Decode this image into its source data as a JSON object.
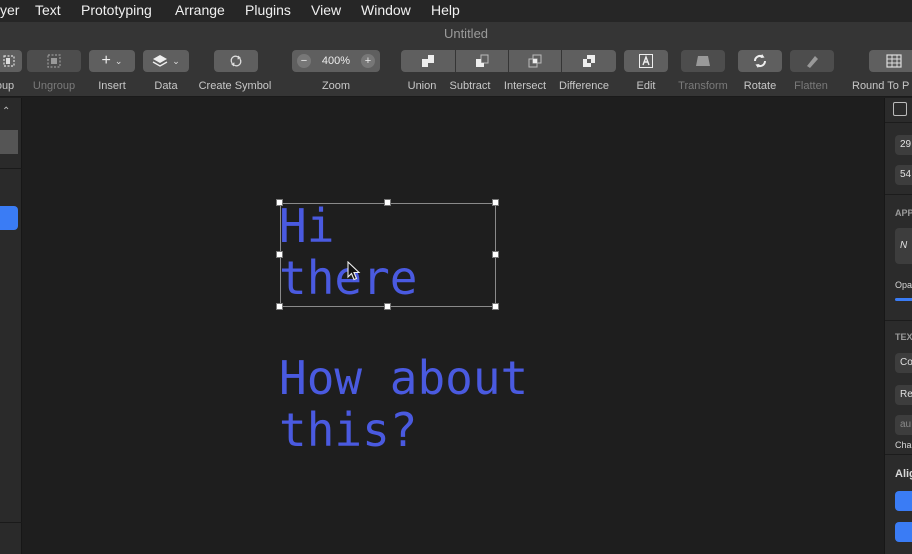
{
  "menu": [
    "yer",
    "Text",
    "Prototyping",
    "Arrange",
    "Plugins",
    "View",
    "Window",
    "Help"
  ],
  "window_title": "Untitled",
  "toolbar": {
    "group": "oup",
    "ungroup": "Ungroup",
    "insert": "Insert",
    "data": "Data",
    "create_symbol": "Create Symbol",
    "zoom_label": "Zoom",
    "zoom_value": "400%",
    "union": "Union",
    "subtract": "Subtract",
    "intersect": "Intersect",
    "difference": "Difference",
    "edit": "Edit",
    "transform": "Transform",
    "rotate": "Rotate",
    "flatten": "Flatten",
    "round_to_pixel": "Round To P"
  },
  "canvas": {
    "text_selected": "Hi\nthere",
    "text_other": "How about\nthis?",
    "text_color": "#4a5ae0"
  },
  "inspector": {
    "pos_x": "29",
    "pos_y": "54",
    "appearance_head": "APP",
    "appearance_field": "N",
    "opacity_label": "Opa",
    "text_head": "TEX",
    "font_field": "Co",
    "weight_field": "Re",
    "auto_field": "au",
    "char_label": "Cha",
    "align_label": "Alig"
  },
  "colors": {
    "accent": "#3a7cf5",
    "canvas_bg": "#1e1e1e",
    "toolbar_bg": "#353535"
  }
}
